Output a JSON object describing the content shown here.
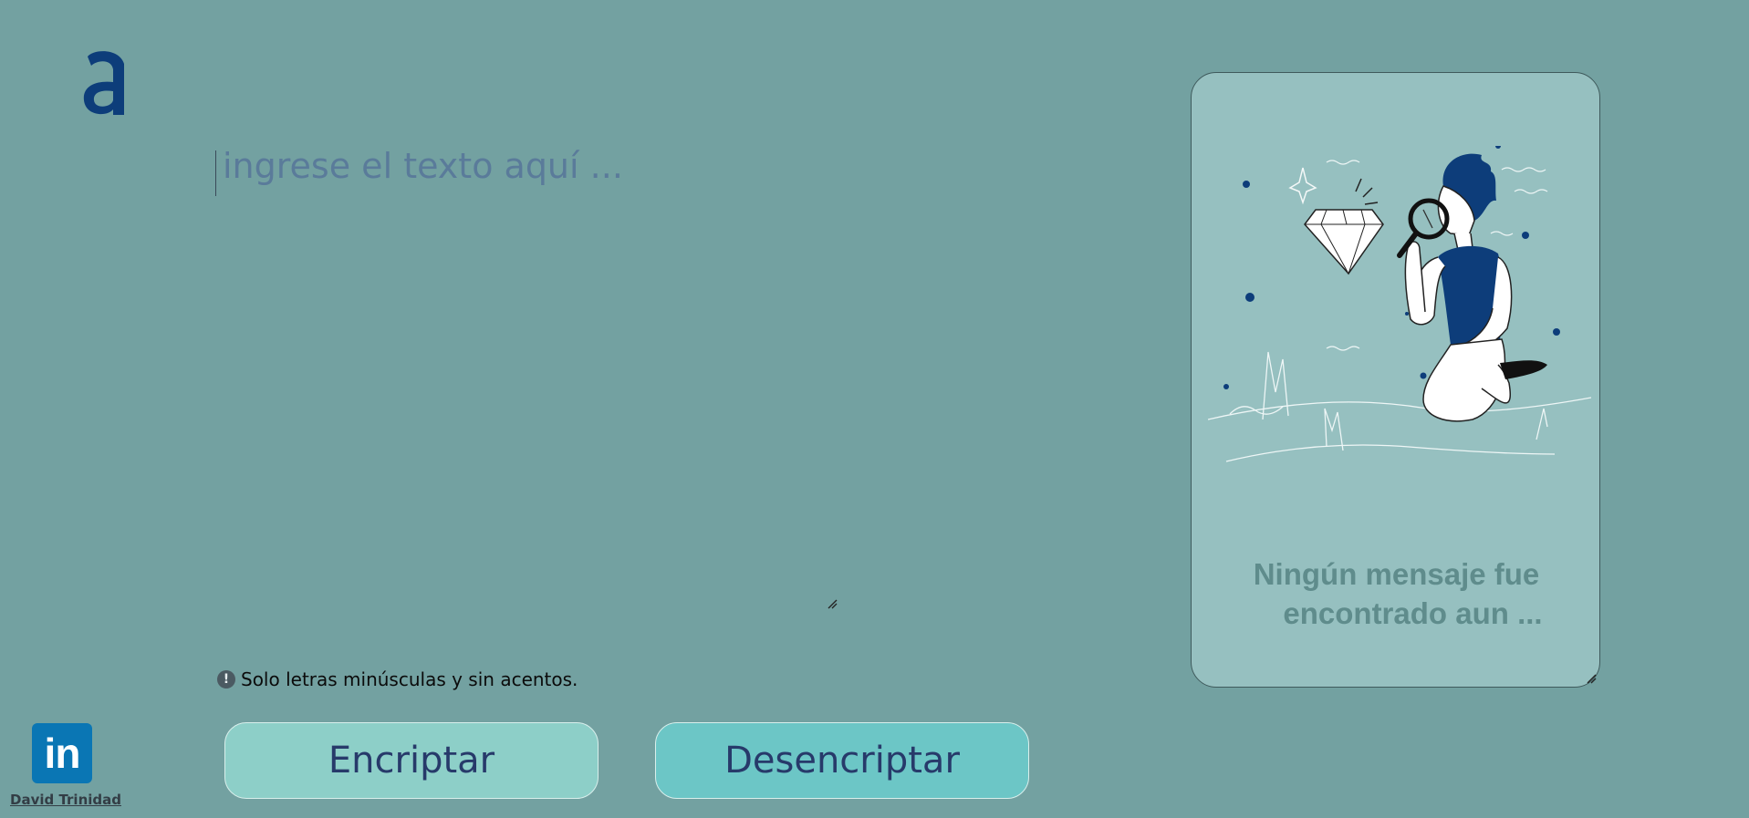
{
  "logo": {
    "letter": "a"
  },
  "input": {
    "placeholder": "ingrese el texto aquí ...",
    "value": ""
  },
  "warning": {
    "icon": "exclamation-icon",
    "text": "Solo letras minúsculas y sin acentos."
  },
  "buttons": {
    "encrypt_label": "Encriptar",
    "decrypt_label": "Desencriptar"
  },
  "footer": {
    "linkedin_icon": "linkedin-icon",
    "linkedin_text": "in",
    "author": "David Trinidad"
  },
  "output": {
    "message_line1": "Ningún mensaje fue",
    "message_line2": "encontrado aun ..."
  },
  "colors": {
    "background": "#73a1a1",
    "panel": "#96c0c0",
    "encrypt_button": "#8dcfc8",
    "decrypt_button": "#6cc6c6",
    "accent_blue": "#0d3d7a",
    "linkedin": "#0a76b4"
  }
}
